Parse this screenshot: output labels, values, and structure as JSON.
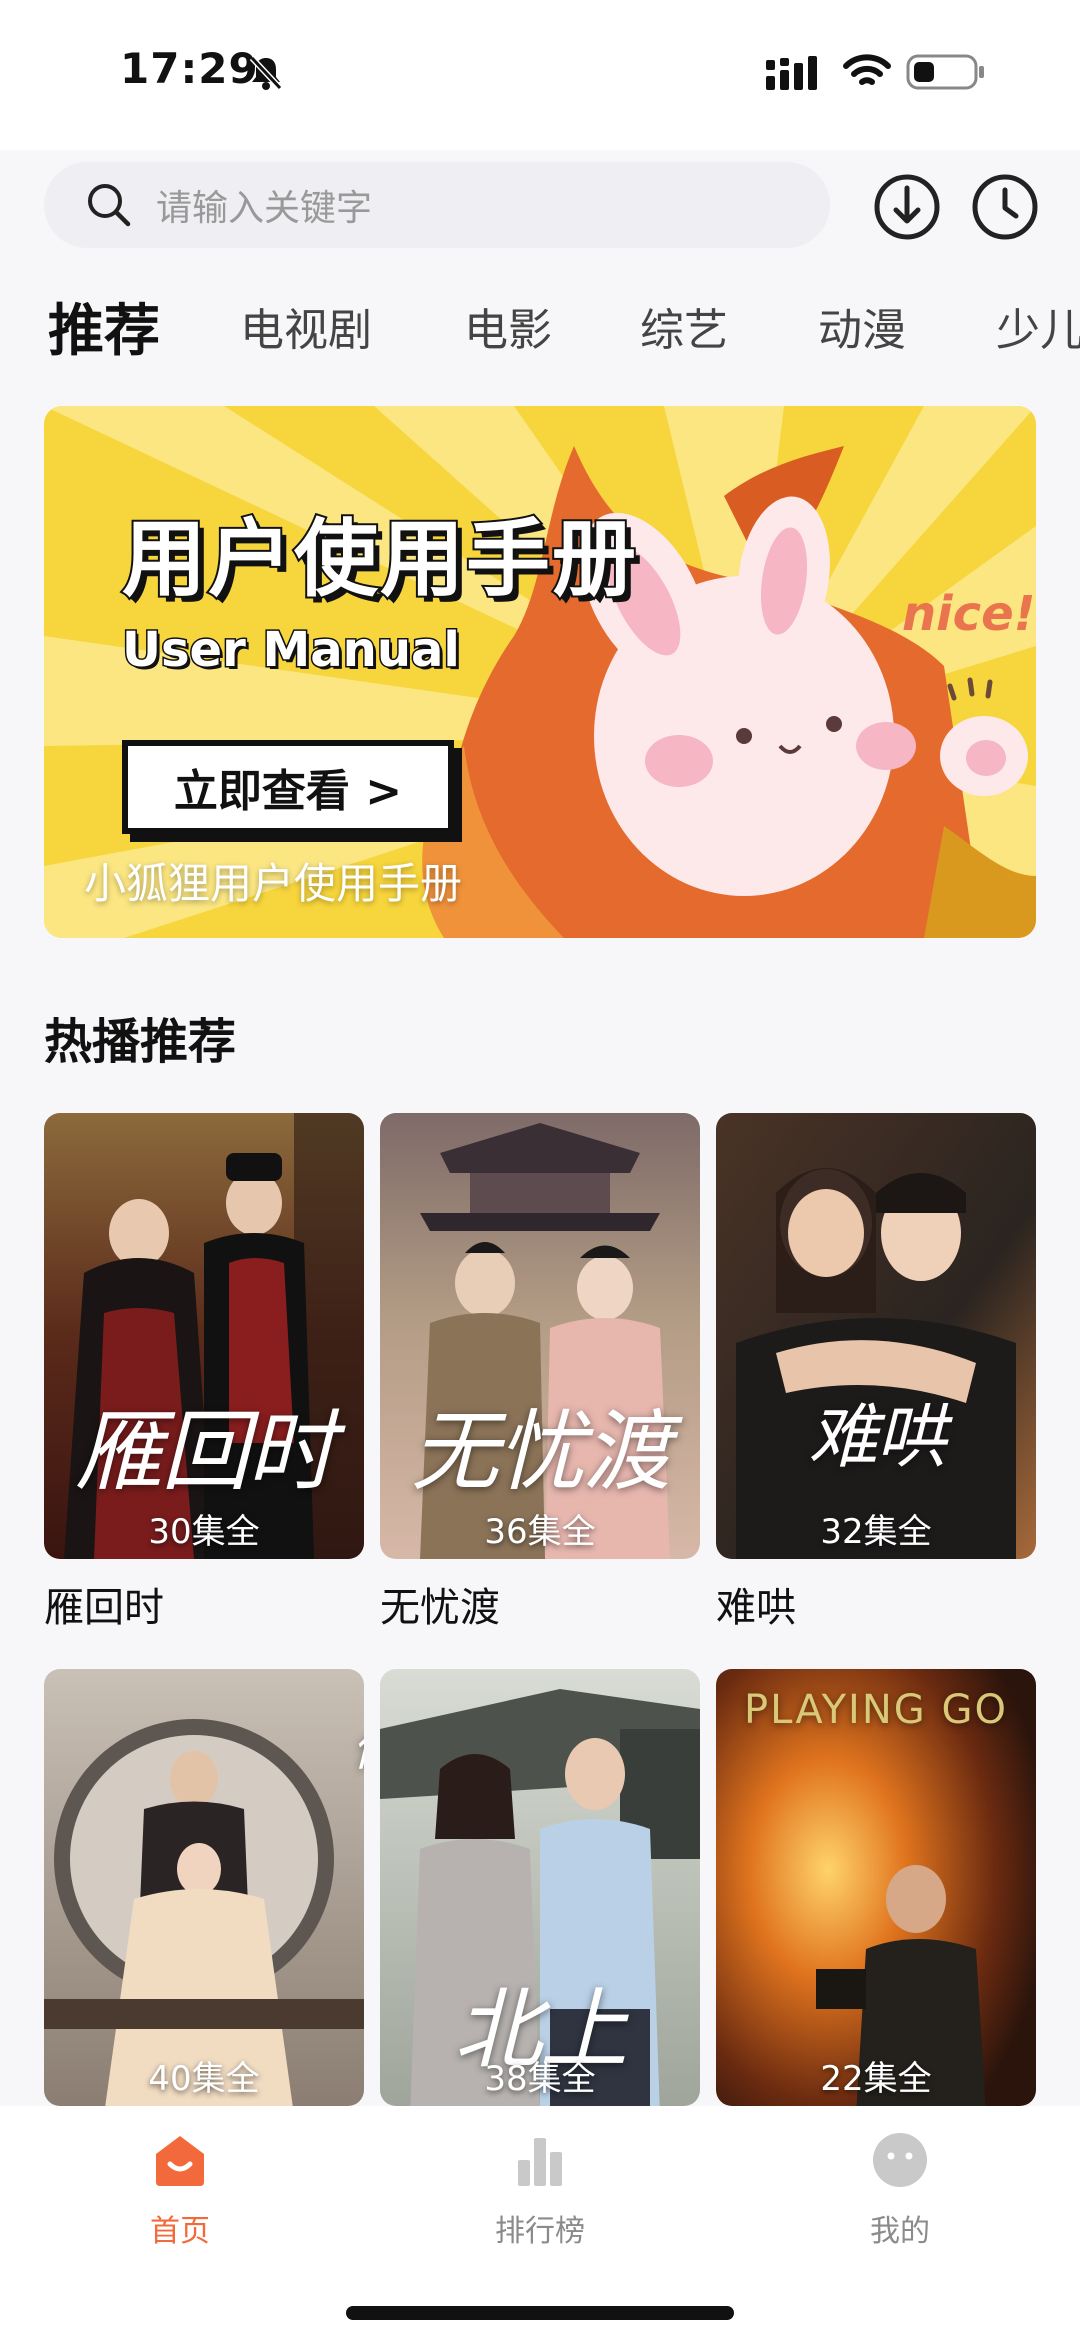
{
  "status_bar": {
    "time": "17:29"
  },
  "search": {
    "placeholder": "请输入关键字"
  },
  "tabs": [
    {
      "label": "推荐",
      "active": true
    },
    {
      "label": "电视剧"
    },
    {
      "label": "电影"
    },
    {
      "label": "综艺"
    },
    {
      "label": "动漫"
    },
    {
      "label": "少儿"
    }
  ],
  "banner": {
    "title": "用户使用手册",
    "subtitle": "User Manual",
    "cta": "立即查看 >",
    "caption": "小狐狸用户使用手册",
    "nice_text": "nice!"
  },
  "section": {
    "title": "热播推荐"
  },
  "dramas": [
    {
      "title": "雁回时",
      "episodes": "30集全",
      "poster_text": "雁回时"
    },
    {
      "title": "无忧渡",
      "episodes": "36集全",
      "poster_text": "无忧渡"
    },
    {
      "title": "难哄",
      "episodes": "32集全",
      "poster_text": "难哄"
    },
    {
      "title": "",
      "episodes": "40集全",
      "poster_text": "仙鸾"
    },
    {
      "title": "",
      "episodes": "38集全",
      "poster_text": "北上"
    },
    {
      "title": "",
      "episodes": "22集全",
      "poster_text": "PLAYING GO"
    }
  ],
  "bottom_nav": [
    {
      "label": "首页",
      "icon": "home-icon",
      "active": true
    },
    {
      "label": "排行榜",
      "icon": "ranking-icon"
    },
    {
      "label": "我的",
      "icon": "profile-icon"
    }
  ],
  "colors": {
    "accent": "#f26a3b",
    "banner_yellow": "#f5d23c",
    "inactive": "#8b8b8b"
  }
}
